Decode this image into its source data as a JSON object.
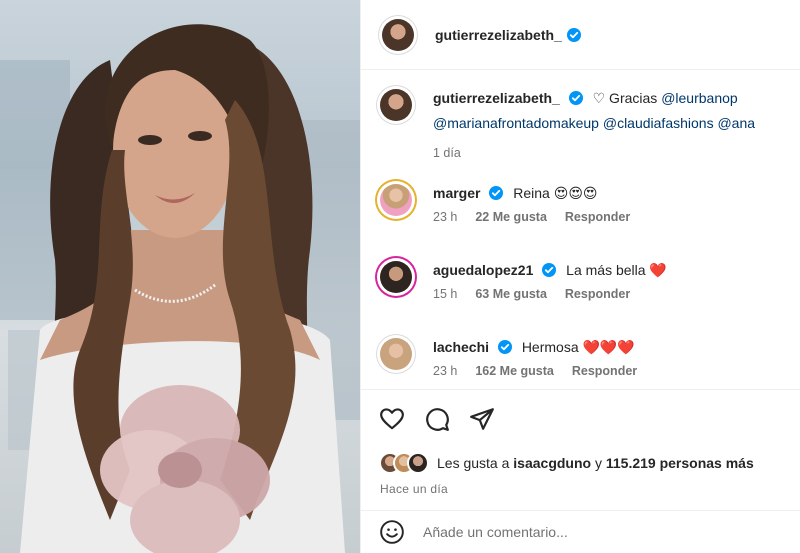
{
  "post": {
    "author": "gutierrezelizabeth_",
    "caption_prefix": "♡ Gracias",
    "caption_mentions_line1": "@leurbanop",
    "caption_mentions_line2": "@marianafrontadomakeup @claudiafashions @ana",
    "caption_age": "1 día"
  },
  "comments": [
    {
      "user": "marger",
      "text": "Reina 😍😍😍",
      "age": "23 h",
      "likes": "22 Me gusta",
      "reply": "Responder"
    },
    {
      "user": "aguedalopez21",
      "text": "La más bella ❤️",
      "age": "15 h",
      "likes": "63 Me gusta",
      "reply": "Responder"
    },
    {
      "user": "lachechi",
      "text": "Hermosa ❤️❤️❤️",
      "age": "23 h",
      "likes": "162 Me gusta",
      "reply": "Responder"
    }
  ],
  "likes": {
    "prefix": "Les gusta a",
    "user": "isaacgduno",
    "middle": "y",
    "count": "115.219 personas más"
  },
  "posted_ago": "Hace un día",
  "add_comment_placeholder": "Añade un comentario...",
  "icons": [
    "heart-icon",
    "comment-icon",
    "share-icon",
    "emoji-icon",
    "verified-badge-icon"
  ],
  "colors": {
    "verified": "#0095f6",
    "mention": "#00376b",
    "muted": "#737373",
    "story_ring": "#d6249f"
  }
}
